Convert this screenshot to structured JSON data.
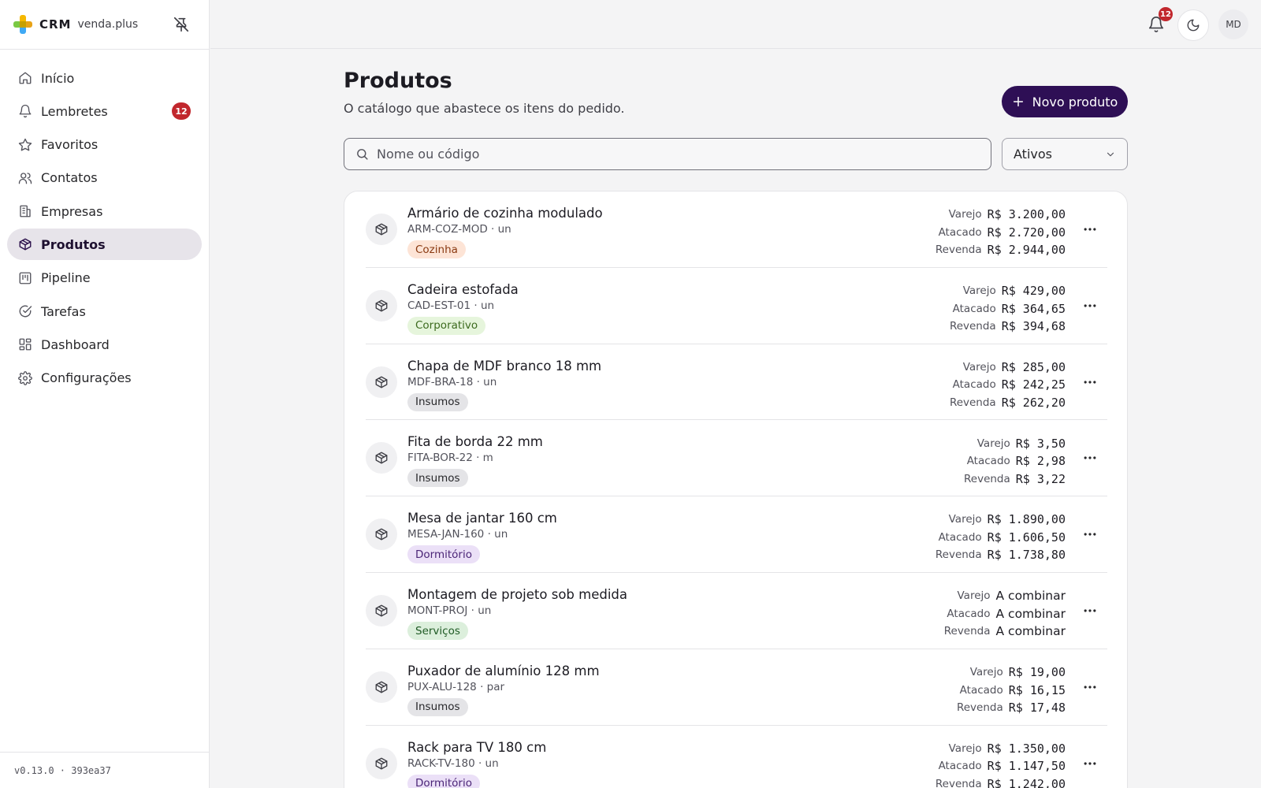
{
  "brand": {
    "name": "CRM",
    "domain": "venda.plus"
  },
  "nav": [
    {
      "label": "Início",
      "icon": "home-icon",
      "active": false
    },
    {
      "label": "Lembretes",
      "icon": "bell-icon",
      "active": false,
      "badge": "12"
    },
    {
      "label": "Favoritos",
      "icon": "star-icon",
      "active": false
    },
    {
      "label": "Contatos",
      "icon": "users-icon",
      "active": false
    },
    {
      "label": "Empresas",
      "icon": "building-icon",
      "active": false
    },
    {
      "label": "Produtos",
      "icon": "package-icon",
      "active": true
    },
    {
      "label": "Pipeline",
      "icon": "kanban-icon",
      "active": false
    },
    {
      "label": "Tarefas",
      "icon": "check-circle-icon",
      "active": false
    },
    {
      "label": "Dashboard",
      "icon": "dashboard-icon",
      "active": false
    },
    {
      "label": "Configurações",
      "icon": "gear-icon",
      "active": false
    }
  ],
  "version": "v0.13.0 · 393ea37",
  "topbar": {
    "notifications": "12",
    "avatar": "MD"
  },
  "page": {
    "title": "Produtos",
    "subtitle": "O catálogo que abastece os itens do pedido.",
    "new_button": "Novo produto",
    "search_placeholder": "Nome ou código",
    "filter_value": "Ativos"
  },
  "price_labels": {
    "retail": "Varejo",
    "wholesale": "Atacado",
    "resale": "Revenda"
  },
  "colors": {
    "accent": "#2e0f55",
    "badge": "#c1272d",
    "tags": {
      "Cozinha": {
        "bg": "#fde4d6",
        "fg": "#8a3a12"
      },
      "Corporativo": {
        "bg": "#e6f5dc",
        "fg": "#3c6a1e"
      },
      "Insumos": {
        "bg": "#e4e4e7",
        "fg": "#27272a"
      },
      "Dormitório": {
        "bg": "#ebe0f7",
        "fg": "#4b2577"
      },
      "Serviços": {
        "bg": "#dcefdc",
        "fg": "#1f5a24"
      }
    }
  },
  "products": [
    {
      "name": "Armário de cozinha modulado",
      "code": "ARM-COZ-MOD · un",
      "tag": "Cozinha",
      "retail": "R$ 3.200,00",
      "wholesale": "R$ 2.720,00",
      "resale": "R$ 2.944,00"
    },
    {
      "name": "Cadeira estofada",
      "code": "CAD-EST-01 · un",
      "tag": "Corporativo",
      "retail": "R$ 429,00",
      "wholesale": "R$ 364,65",
      "resale": "R$ 394,68"
    },
    {
      "name": "Chapa de MDF branco 18 mm",
      "code": "MDF-BRA-18 · un",
      "tag": "Insumos",
      "retail": "R$ 285,00",
      "wholesale": "R$ 242,25",
      "resale": "R$ 262,20"
    },
    {
      "name": "Fita de borda 22 mm",
      "code": "FITA-BOR-22 · m",
      "tag": "Insumos",
      "retail": "R$ 3,50",
      "wholesale": "R$ 2,98",
      "resale": "R$ 3,22"
    },
    {
      "name": "Mesa de jantar 160 cm",
      "code": "MESA-JAN-160 · un",
      "tag": "Dormitório",
      "retail": "R$ 1.890,00",
      "wholesale": "R$ 1.606,50",
      "resale": "R$ 1.738,80"
    },
    {
      "name": "Montagem de projeto sob medida",
      "code": "MONT-PROJ · un",
      "tag": "Serviços",
      "retail": "A combinar",
      "wholesale": "A combinar",
      "resale": "A combinar"
    },
    {
      "name": "Puxador de alumínio 128 mm",
      "code": "PUX-ALU-128 · par",
      "tag": "Insumos",
      "retail": "R$ 19,00",
      "wholesale": "R$ 16,15",
      "resale": "R$ 17,48"
    },
    {
      "name": "Rack para TV 180 cm",
      "code": "RACK-TV-180 · un",
      "tag": "Dormitório",
      "retail": "R$ 1.350,00",
      "wholesale": "R$ 1.147,50",
      "resale": "R$ 1.242,00"
    }
  ]
}
